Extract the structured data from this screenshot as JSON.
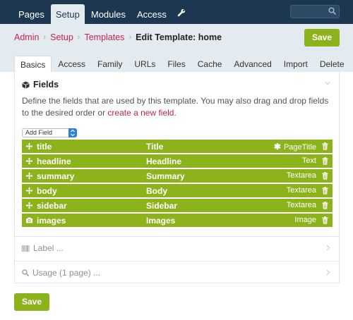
{
  "topnav": {
    "items": [
      "Pages",
      "Setup",
      "Modules",
      "Access"
    ],
    "active": "Setup",
    "wrench_icon": "wrench-icon"
  },
  "search": {
    "value": "",
    "icon": "search-icon"
  },
  "breadcrumb": {
    "links": [
      "Admin",
      "Setup",
      "Templates"
    ],
    "current": "Edit Template: home"
  },
  "actions": {
    "save_label": "Save",
    "save_bottom_label": "Save"
  },
  "tabs": [
    "Basics",
    "Access",
    "Family",
    "URLs",
    "Files",
    "Cache",
    "Advanced",
    "Import",
    "Delete"
  ],
  "fields_section": {
    "title": "Fields",
    "description": "Define the fields that are used by this template. You may also drag and drop fields to the desired order or",
    "create_link": "create a new field",
    "add_field_label": "Add Field"
  },
  "fields": [
    {
      "name": "title",
      "label": "Title",
      "type": "PageTitle",
      "required": true,
      "icon": "move-icon"
    },
    {
      "name": "headline",
      "label": "Headline",
      "type": "Text",
      "required": false,
      "icon": "move-icon"
    },
    {
      "name": "summary",
      "label": "Summary",
      "type": "Textarea",
      "required": false,
      "icon": "move-icon"
    },
    {
      "name": "body",
      "label": "Body",
      "type": "Textarea",
      "required": false,
      "icon": "move-icon"
    },
    {
      "name": "sidebar",
      "label": "Sidebar",
      "type": "Textarea",
      "required": false,
      "icon": "move-icon"
    },
    {
      "name": "images",
      "label": "Images",
      "type": "Image",
      "required": false,
      "icon": "camera-icon"
    }
  ],
  "collapsed_sections": {
    "label": "Label ...",
    "usage": "Usage (1 page) ..."
  },
  "colors": {
    "topbar": "#1d3750",
    "header_band": "#e4ebf0",
    "accent_green": "#8cb21c",
    "link_red": "#c0244f"
  }
}
